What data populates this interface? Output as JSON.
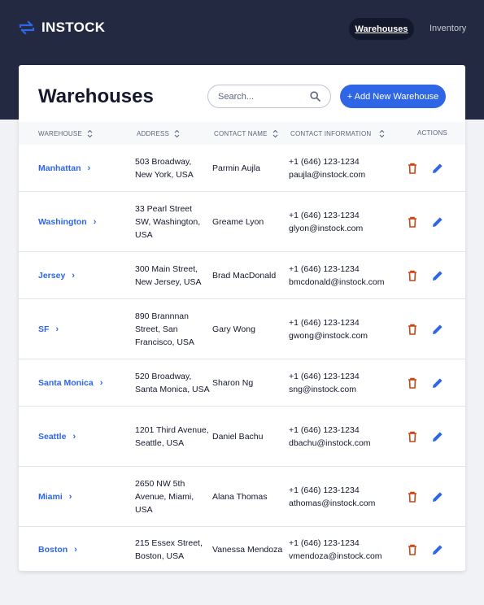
{
  "app": {
    "name": "INSTOCK"
  },
  "nav": {
    "warehouses": "Warehouses",
    "inventory": "Inventory"
  },
  "page": {
    "title": "Warehouses",
    "search_placeholder": "Search...",
    "add_button": "+ Add New Warehouse"
  },
  "colors": {
    "header": "#232940",
    "accent": "#2e66e6",
    "delete": "#c94515",
    "text": "#13182c",
    "muted": "#5c667e"
  },
  "icons": {
    "logo": "swap-arrows-icon",
    "search": "search-icon",
    "sort": "sort-icon",
    "chevron": "chevron-right-icon",
    "delete": "trash-icon",
    "edit": "pencil-icon"
  },
  "table": {
    "headers": [
      "WAREHOUSE",
      "ADDRESS",
      "CONTACT NAME",
      "CONTACT INFORMATION",
      "ACTIONS"
    ],
    "rows": [
      {
        "warehouse": "Manhattan",
        "address": "503 Broadway, New York, USA",
        "contact": "Parmin Aujla",
        "phone": "+1 (646) 123-1234",
        "email": "paujla@instock.com"
      },
      {
        "warehouse": "Washington",
        "address": "33 Pearl Street SW, Washington, USA",
        "contact": "Greame Lyon",
        "phone": "+1 (646) 123-1234",
        "email": "glyon@instock.com"
      },
      {
        "warehouse": "Jersey",
        "address": "300 Main Street, New Jersey, USA",
        "contact": "Brad MacDonald",
        "phone": "+1 (646) 123-1234",
        "email": "bmcdonald@instock.com"
      },
      {
        "warehouse": "SF",
        "address": "890 Brannnan Street, San Francisco, USA",
        "contact": "Gary Wong",
        "phone": "+1 (646) 123-1234",
        "email": "gwong@instock.com"
      },
      {
        "warehouse": "Santa Monica",
        "address": "520 Broadway, Santa Monica, USA",
        "contact": "Sharon Ng",
        "phone": "+1 (646) 123-1234",
        "email": "sng@instock.com"
      },
      {
        "warehouse": "Seattle",
        "address": "1201 Third Avenue, Seattle, USA",
        "contact": "Daniel Bachu",
        "phone": "+1 (646) 123-1234",
        "email": "dbachu@instock.com"
      },
      {
        "warehouse": "Miami",
        "address": "2650 NW 5th Avenue, Miami, USA",
        "contact": "Alana Thomas",
        "phone": "+1 (646) 123-1234",
        "email": "athomas@instock.com"
      },
      {
        "warehouse": "Boston",
        "address": "215 Essex Street, Boston, USA",
        "contact": "Vanessa Mendoza",
        "phone": "+1 (646) 123-1234",
        "email": "vmendoza@instock.com"
      }
    ]
  }
}
